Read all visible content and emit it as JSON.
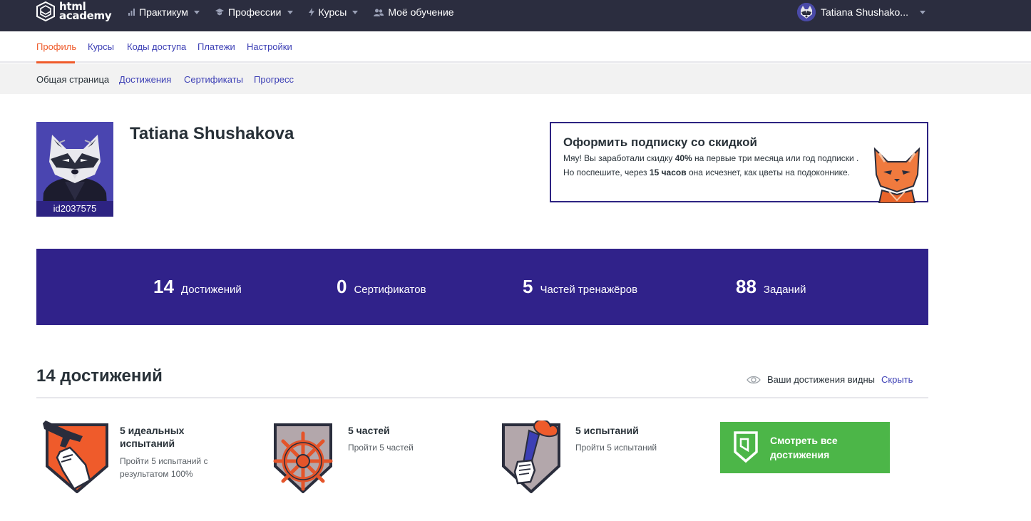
{
  "header": {
    "logo_line1": "html",
    "logo_line2": "academy",
    "nav": [
      {
        "label": "Практикум",
        "icon": "chart-icon"
      },
      {
        "label": "Профессии",
        "icon": "graduation-cap-icon"
      },
      {
        "label": "Курсы",
        "icon": "lightning-icon"
      },
      {
        "label": "Моё обучение",
        "icon": "people-icon"
      }
    ],
    "user_name": "Tatiana Shushako..."
  },
  "tabs": [
    "Профиль",
    "Курсы",
    "Коды доступа",
    "Платежи",
    "Настройки"
  ],
  "subtabs": [
    "Общая страница",
    "Достижения",
    "Сертификаты",
    "Прогресс"
  ],
  "profile": {
    "id": "id2037575",
    "name": "Tatiana Shushakova"
  },
  "promo": {
    "title": "Оформить подписку со скидкой",
    "text_1": "Мяу! Вы заработали скидку ",
    "discount": "40%",
    "text_2": " на первые три месяца или год подписки . Но поспешите, через ",
    "hours": "15 часов",
    "text_3": " она исчезнет, как цветы на подоконнике."
  },
  "stats": [
    {
      "value": "14",
      "label": "Достижений"
    },
    {
      "value": "0",
      "label": "Сертификатов"
    },
    {
      "value": "5",
      "label": "Частей тренажёров"
    },
    {
      "value": "88",
      "label": "Заданий"
    }
  ],
  "achievements": {
    "title": "14 достижений",
    "visibility_text": "Ваши достижения видны",
    "hide_label": "Скрыть",
    "items": [
      {
        "name": "5 идеальных испытаний",
        "desc": "Пройти 5 испытаний с результатом 100%",
        "icon": "pistol-hand-icon"
      },
      {
        "name": "5 частей",
        "desc": "Пройти 5 частей",
        "icon": "ship-wheel-icon"
      },
      {
        "name": "5 испытаний",
        "desc": "Пройти 5 испытаний",
        "icon": "torch-hand-icon"
      }
    ],
    "view_all_label": "Смотреть все достижения"
  },
  "colors": {
    "header_bg": "#2b2d3f",
    "accent_orange": "#ef5b2b",
    "link_blue": "#3c3fb5",
    "stats_bg": "#30228a",
    "green_button": "#4cb648"
  }
}
